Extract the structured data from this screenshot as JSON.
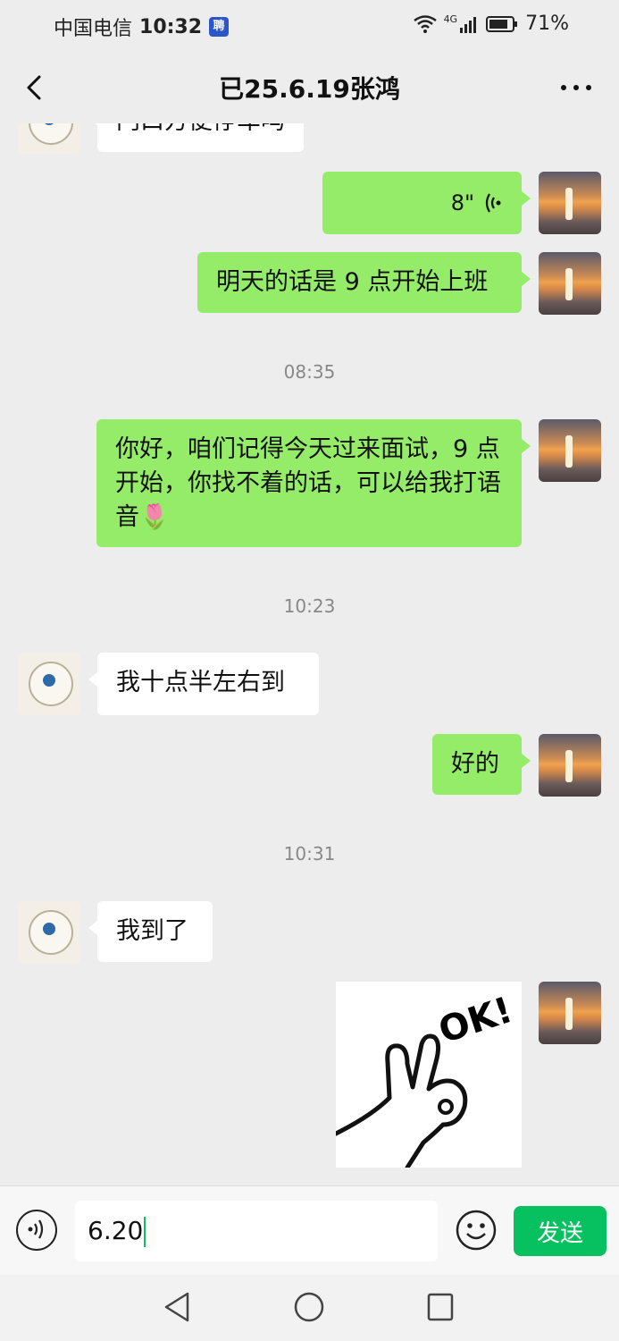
{
  "status_bar": {
    "carrier": "中国电信",
    "time": "10:32",
    "badge": "聘",
    "network": "4G",
    "battery": "71%"
  },
  "header": {
    "title": "已25.6.19张鸿"
  },
  "messages": {
    "partial_top": "门口方便停车吗",
    "voice_duration": "8\"",
    "m1": "明天的话是 9 点开始上班",
    "ts1": "08:35",
    "m2": "你好，咱们记得今天过来面试，9 点开始，你找不着的话，可以给我打语音🌷",
    "ts2": "10:23",
    "m3": "我十点半左右到",
    "m4": "好的",
    "ts3": "10:31",
    "m5": "我到了",
    "sticker_text": "OK!"
  },
  "input_bar": {
    "value": "6.20",
    "send_label": "发送"
  },
  "colors": {
    "self_bubble": "#95ec69",
    "other_bubble": "#ffffff",
    "send_button": "#07c160",
    "background": "#ededed"
  },
  "icons": [
    "back-arrow-icon",
    "more-icon",
    "voice-wave-icon",
    "voice-input-icon",
    "emoji-icon",
    "nav-back-icon",
    "nav-home-icon",
    "nav-recents-icon"
  ]
}
